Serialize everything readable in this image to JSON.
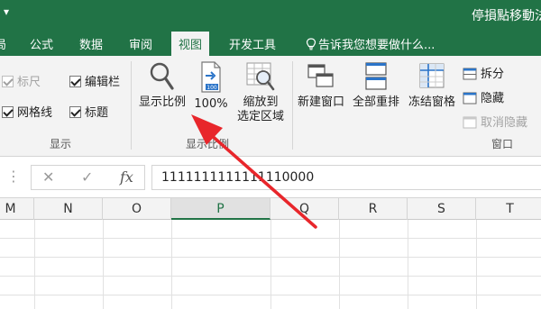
{
  "title_bar": {
    "title": "停損點移動法",
    "quick_access": "▾"
  },
  "ribbon_tabs": {
    "tabs": [
      "局",
      "公式",
      "数据",
      "审阅",
      "视图",
      "开发工具"
    ],
    "active": "视图",
    "tell_me": "告诉我您想要做什么..."
  },
  "show_group": {
    "label": "显示",
    "checkboxes": [
      {
        "label": "标尺",
        "checked": true,
        "disabled": true
      },
      {
        "label": "编辑栏",
        "checked": true,
        "disabled": false
      },
      {
        "label": "网格线",
        "checked": true,
        "disabled": false
      },
      {
        "label": "标题",
        "checked": true,
        "disabled": false
      }
    ]
  },
  "zoom_group": {
    "label": "显示比例",
    "zoom_button": "显示比例",
    "hundred_button": "100%",
    "fit_selection_line1": "缩放到",
    "fit_selection_line2": "选定区域"
  },
  "window_group": {
    "label": "窗口",
    "new_window": "新建窗口",
    "arrange_all": "全部重排",
    "freeze_panes": "冻结窗格",
    "split": "拆分",
    "hide": "隐藏",
    "unhide": "取消隐藏"
  },
  "formula_bar": {
    "cancel_glyph": "✕",
    "enter_glyph": "✓",
    "fx_glyph": "fx",
    "value": "1111111111111110000"
  },
  "columns": [
    "M",
    "N",
    "O",
    "P",
    "Q",
    "R",
    "S",
    "T"
  ],
  "selected_column": "P",
  "colors": {
    "accent": "#217346",
    "arrow": "#e8262b"
  }
}
